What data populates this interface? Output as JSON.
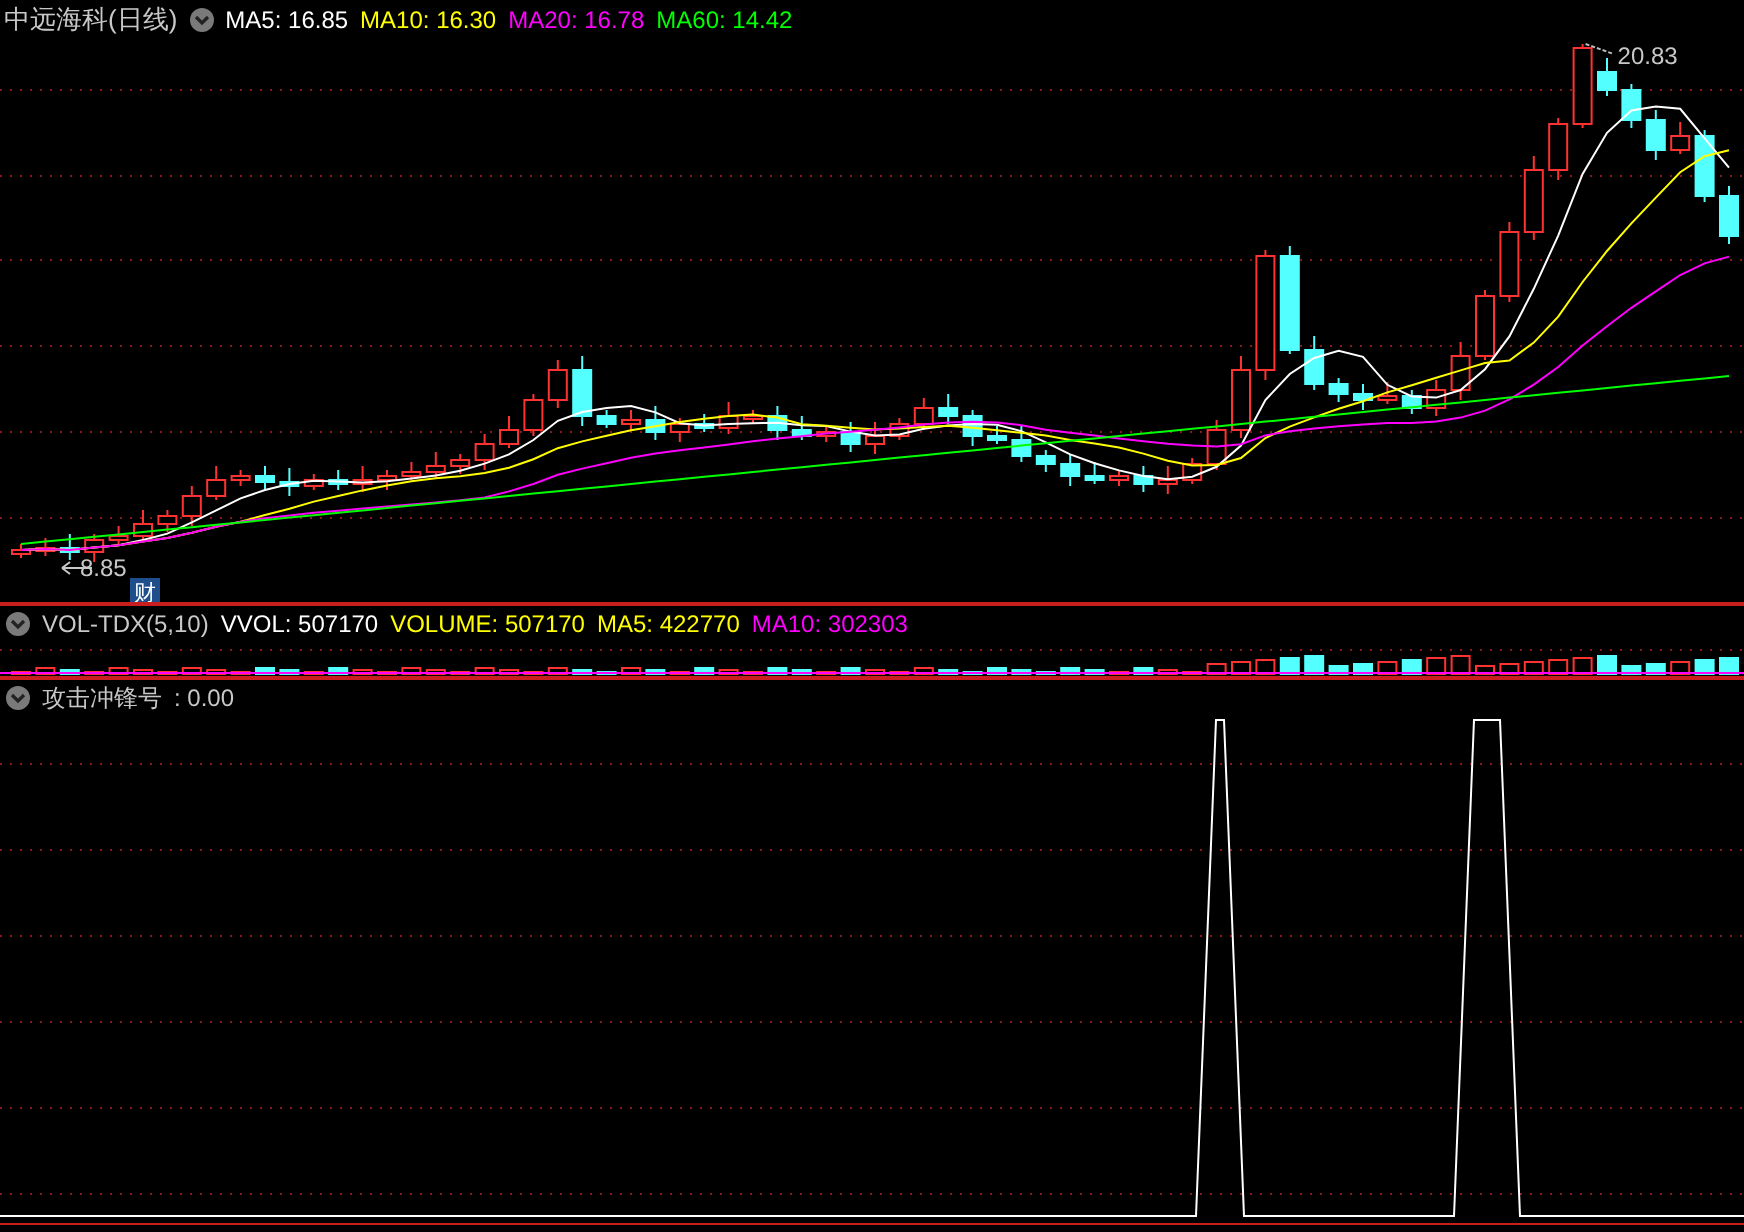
{
  "main_panel": {
    "title": "中远海科(日线)",
    "indicators": [
      {
        "label": "MA5: 16.85",
        "color": "#ffffff"
      },
      {
        "label": "MA10: 16.30",
        "color": "#ffff00"
      },
      {
        "label": "MA20: 16.78",
        "color": "#ff00ff"
      },
      {
        "label": "MA60: 14.42",
        "color": "#00ff00"
      }
    ],
    "high_label": "20.83",
    "low_label": "8.85",
    "badge": "财"
  },
  "volume_panel": {
    "title": "VOL-TDX(5,10)",
    "readings": [
      {
        "label": "VVOL: 507170",
        "color": "#ffffff"
      },
      {
        "label": "VOLUME: 507170",
        "color": "#ffff00"
      },
      {
        "label": "MA5: 422770",
        "color": "#ffff00"
      },
      {
        "label": "MA10: 302303",
        "color": "#ff00ff"
      }
    ]
  },
  "signal_panel": {
    "title": "攻击冲锋号",
    "reading": ": 0.00"
  }
}
